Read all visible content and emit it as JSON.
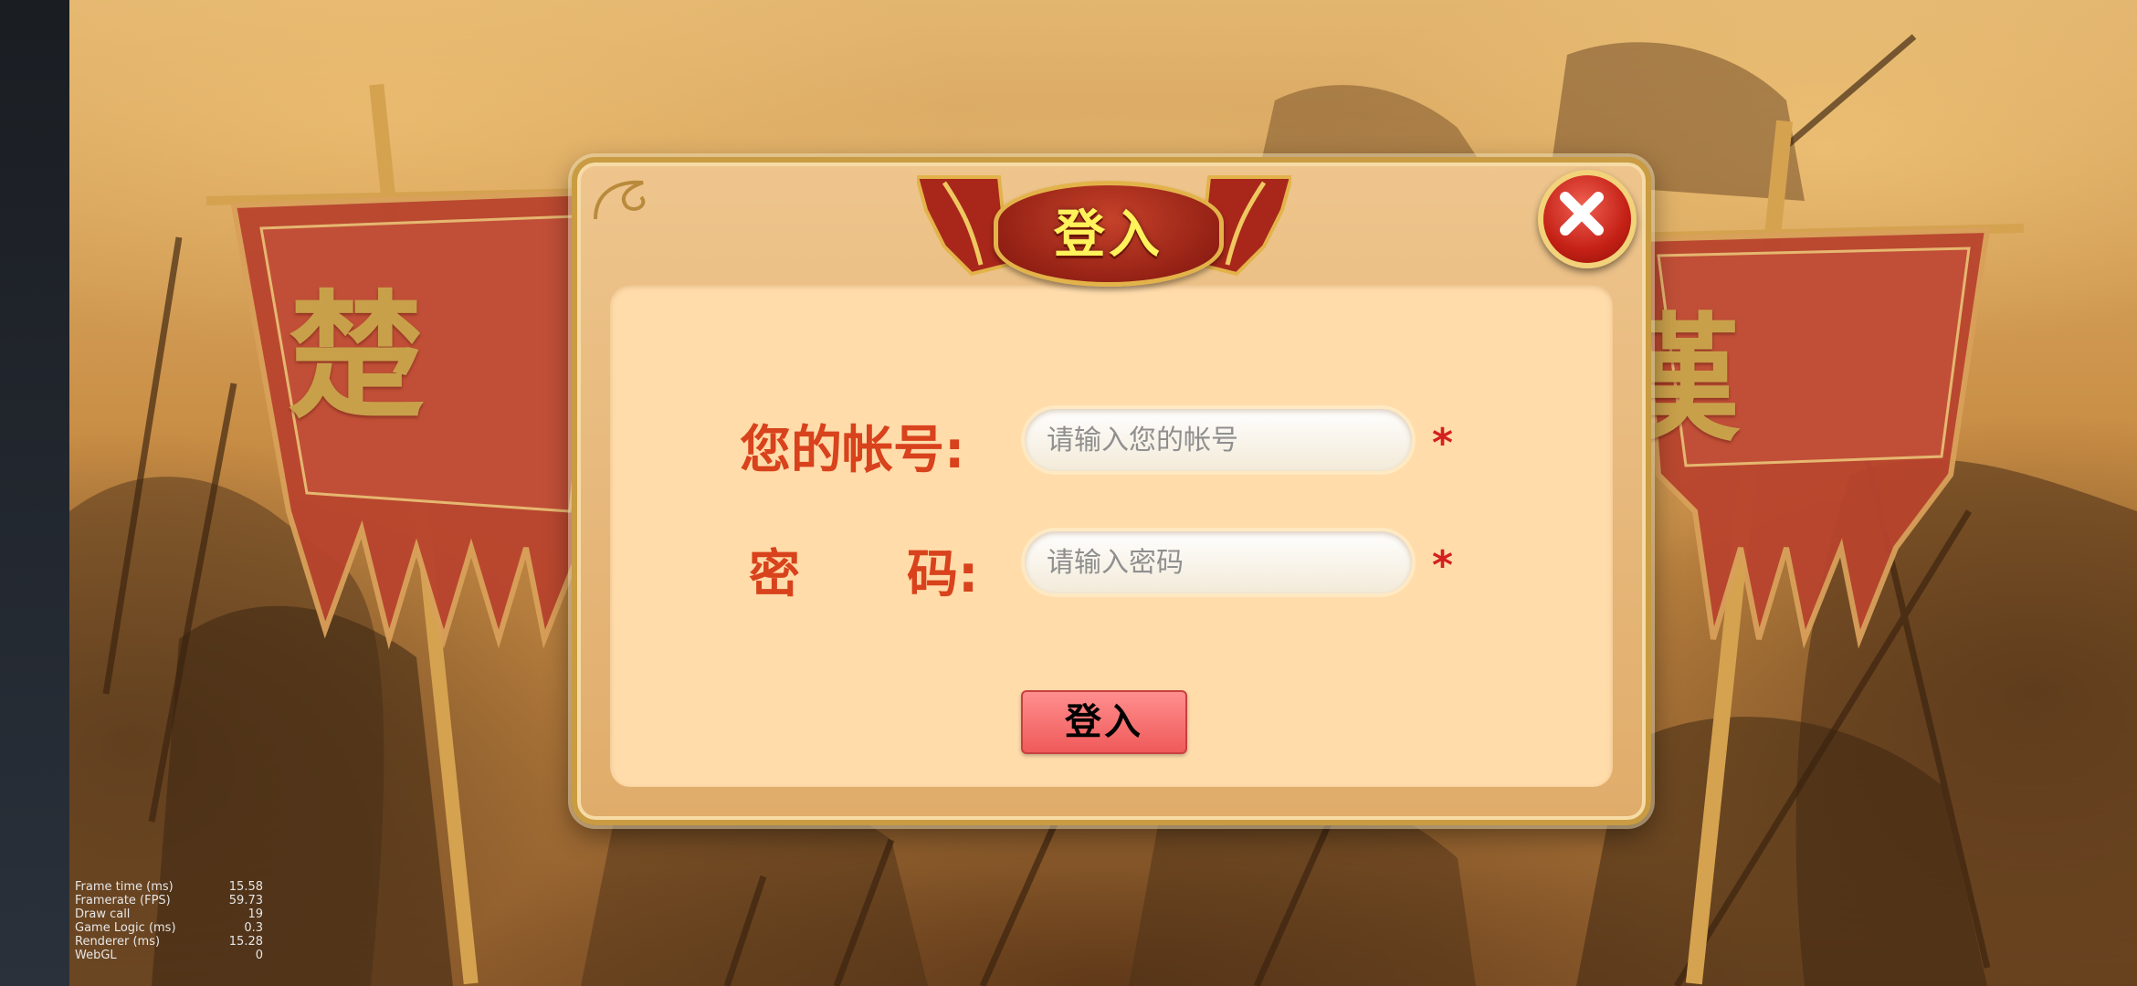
{
  "dialog": {
    "title": "登入",
    "account_label": "您的帐号:",
    "account_placeholder": "请输入您的帐号",
    "password_label": "密      码:",
    "password_placeholder": "请输入密码",
    "required_mark": "*",
    "submit_label": "登入"
  },
  "background": {
    "left_banner": "楚",
    "right_banner": "漢"
  },
  "stats": [
    {
      "label": "Frame time (ms)",
      "value": "15.58"
    },
    {
      "label": "Framerate (FPS)",
      "value": "59.73"
    },
    {
      "label": "Draw call",
      "value": "19"
    },
    {
      "label": "Game Logic (ms)",
      "value": "0.3"
    },
    {
      "label": "Renderer (ms)",
      "value": "15.28"
    },
    {
      "label": "WebGL",
      "value": "0"
    }
  ],
  "colors": {
    "label": "#d8421c",
    "required": "#d42020",
    "submit": "#f05a5a",
    "title_text": "#fff25a",
    "panel": "#ffdcaa"
  },
  "icons": {
    "close": "close-icon",
    "required": "asterisk"
  }
}
